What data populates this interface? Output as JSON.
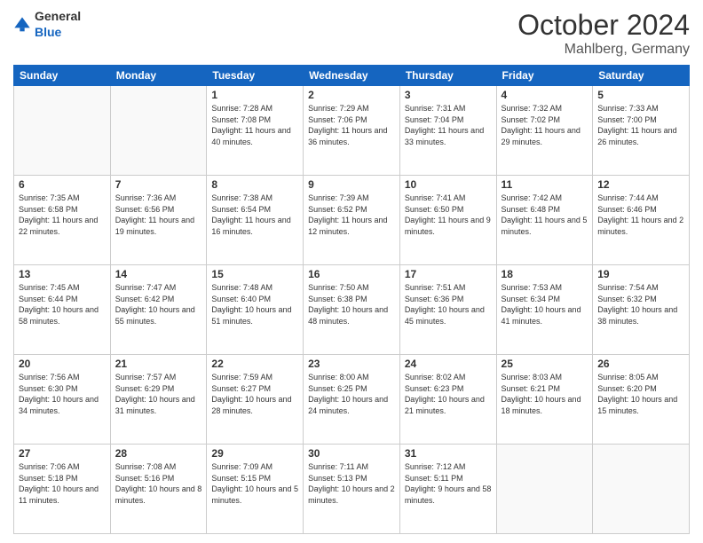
{
  "header": {
    "logo_general": "General",
    "logo_blue": "Blue",
    "month_title": "October 2024",
    "location": "Mahlberg, Germany"
  },
  "days_of_week": [
    "Sunday",
    "Monday",
    "Tuesday",
    "Wednesday",
    "Thursday",
    "Friday",
    "Saturday"
  ],
  "weeks": [
    [
      {
        "day": "",
        "info": ""
      },
      {
        "day": "",
        "info": ""
      },
      {
        "day": "1",
        "info": "Sunrise: 7:28 AM\nSunset: 7:08 PM\nDaylight: 11 hours and 40 minutes."
      },
      {
        "day": "2",
        "info": "Sunrise: 7:29 AM\nSunset: 7:06 PM\nDaylight: 11 hours and 36 minutes."
      },
      {
        "day": "3",
        "info": "Sunrise: 7:31 AM\nSunset: 7:04 PM\nDaylight: 11 hours and 33 minutes."
      },
      {
        "day": "4",
        "info": "Sunrise: 7:32 AM\nSunset: 7:02 PM\nDaylight: 11 hours and 29 minutes."
      },
      {
        "day": "5",
        "info": "Sunrise: 7:33 AM\nSunset: 7:00 PM\nDaylight: 11 hours and 26 minutes."
      }
    ],
    [
      {
        "day": "6",
        "info": "Sunrise: 7:35 AM\nSunset: 6:58 PM\nDaylight: 11 hours and 22 minutes."
      },
      {
        "day": "7",
        "info": "Sunrise: 7:36 AM\nSunset: 6:56 PM\nDaylight: 11 hours and 19 minutes."
      },
      {
        "day": "8",
        "info": "Sunrise: 7:38 AM\nSunset: 6:54 PM\nDaylight: 11 hours and 16 minutes."
      },
      {
        "day": "9",
        "info": "Sunrise: 7:39 AM\nSunset: 6:52 PM\nDaylight: 11 hours and 12 minutes."
      },
      {
        "day": "10",
        "info": "Sunrise: 7:41 AM\nSunset: 6:50 PM\nDaylight: 11 hours and 9 minutes."
      },
      {
        "day": "11",
        "info": "Sunrise: 7:42 AM\nSunset: 6:48 PM\nDaylight: 11 hours and 5 minutes."
      },
      {
        "day": "12",
        "info": "Sunrise: 7:44 AM\nSunset: 6:46 PM\nDaylight: 11 hours and 2 minutes."
      }
    ],
    [
      {
        "day": "13",
        "info": "Sunrise: 7:45 AM\nSunset: 6:44 PM\nDaylight: 10 hours and 58 minutes."
      },
      {
        "day": "14",
        "info": "Sunrise: 7:47 AM\nSunset: 6:42 PM\nDaylight: 10 hours and 55 minutes."
      },
      {
        "day": "15",
        "info": "Sunrise: 7:48 AM\nSunset: 6:40 PM\nDaylight: 10 hours and 51 minutes."
      },
      {
        "day": "16",
        "info": "Sunrise: 7:50 AM\nSunset: 6:38 PM\nDaylight: 10 hours and 48 minutes."
      },
      {
        "day": "17",
        "info": "Sunrise: 7:51 AM\nSunset: 6:36 PM\nDaylight: 10 hours and 45 minutes."
      },
      {
        "day": "18",
        "info": "Sunrise: 7:53 AM\nSunset: 6:34 PM\nDaylight: 10 hours and 41 minutes."
      },
      {
        "day": "19",
        "info": "Sunrise: 7:54 AM\nSunset: 6:32 PM\nDaylight: 10 hours and 38 minutes."
      }
    ],
    [
      {
        "day": "20",
        "info": "Sunrise: 7:56 AM\nSunset: 6:30 PM\nDaylight: 10 hours and 34 minutes."
      },
      {
        "day": "21",
        "info": "Sunrise: 7:57 AM\nSunset: 6:29 PM\nDaylight: 10 hours and 31 minutes."
      },
      {
        "day": "22",
        "info": "Sunrise: 7:59 AM\nSunset: 6:27 PM\nDaylight: 10 hours and 28 minutes."
      },
      {
        "day": "23",
        "info": "Sunrise: 8:00 AM\nSunset: 6:25 PM\nDaylight: 10 hours and 24 minutes."
      },
      {
        "day": "24",
        "info": "Sunrise: 8:02 AM\nSunset: 6:23 PM\nDaylight: 10 hours and 21 minutes."
      },
      {
        "day": "25",
        "info": "Sunrise: 8:03 AM\nSunset: 6:21 PM\nDaylight: 10 hours and 18 minutes."
      },
      {
        "day": "26",
        "info": "Sunrise: 8:05 AM\nSunset: 6:20 PM\nDaylight: 10 hours and 15 minutes."
      }
    ],
    [
      {
        "day": "27",
        "info": "Sunrise: 7:06 AM\nSunset: 5:18 PM\nDaylight: 10 hours and 11 minutes."
      },
      {
        "day": "28",
        "info": "Sunrise: 7:08 AM\nSunset: 5:16 PM\nDaylight: 10 hours and 8 minutes."
      },
      {
        "day": "29",
        "info": "Sunrise: 7:09 AM\nSunset: 5:15 PM\nDaylight: 10 hours and 5 minutes."
      },
      {
        "day": "30",
        "info": "Sunrise: 7:11 AM\nSunset: 5:13 PM\nDaylight: 10 hours and 2 minutes."
      },
      {
        "day": "31",
        "info": "Sunrise: 7:12 AM\nSunset: 5:11 PM\nDaylight: 9 hours and 58 minutes."
      },
      {
        "day": "",
        "info": ""
      },
      {
        "day": "",
        "info": ""
      }
    ]
  ]
}
